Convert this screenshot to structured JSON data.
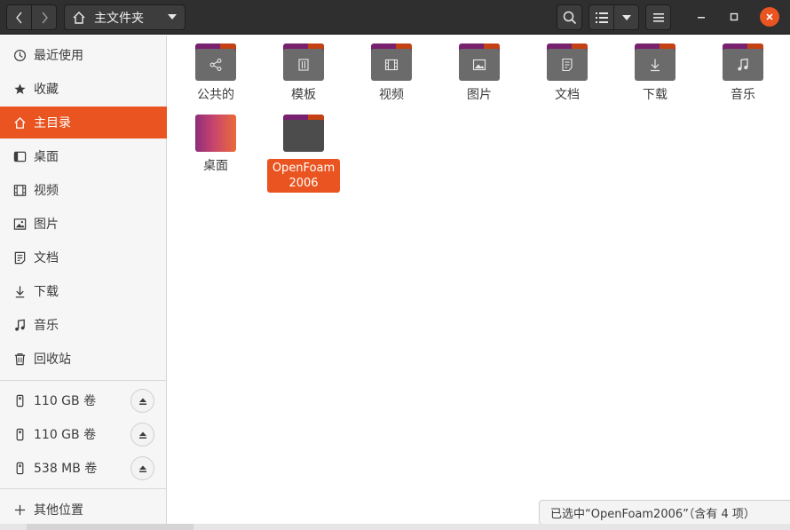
{
  "header": {
    "path_label": "主文件夹"
  },
  "sidebar": {
    "places": [
      {
        "label": "最近使用",
        "icon": "clock-icon"
      },
      {
        "label": "收藏",
        "icon": "star-icon"
      },
      {
        "label": "主目录",
        "icon": "home-icon",
        "active": true
      },
      {
        "label": "桌面",
        "icon": "desktop-icon"
      },
      {
        "label": "视频",
        "icon": "film-icon"
      },
      {
        "label": "图片",
        "icon": "picture-icon"
      },
      {
        "label": "文档",
        "icon": "document-icon"
      },
      {
        "label": "下载",
        "icon": "download-icon"
      },
      {
        "label": "音乐",
        "icon": "music-icon"
      },
      {
        "label": "回收站",
        "icon": "trash-icon"
      }
    ],
    "devices": [
      {
        "label": "110 GB 卷",
        "icon": "usb-drive-icon"
      },
      {
        "label": "110 GB 卷",
        "icon": "usb-drive-icon"
      },
      {
        "label": "538 MB 卷",
        "icon": "usb-drive-icon"
      }
    ],
    "other_locations": "其他位置"
  },
  "files": [
    {
      "name": "公共的",
      "icon": "share-icon"
    },
    {
      "name": "模板",
      "icon": "template-icon"
    },
    {
      "name": "视频",
      "icon": "film-icon"
    },
    {
      "name": "图片",
      "icon": "picture-icon"
    },
    {
      "name": "文档",
      "icon": "document-icon"
    },
    {
      "name": "下载",
      "icon": "download-icon"
    },
    {
      "name": "音乐",
      "icon": "music-icon"
    },
    {
      "name": "桌面",
      "icon": "desktop-icon"
    },
    {
      "name": "OpenFoam\n2006",
      "icon": "folder-icon",
      "selected": true
    }
  ],
  "status": "已选中“OpenFoam2006”（含有 4 项）",
  "colors": {
    "accent": "#e95420",
    "header_bg": "#2f2f2f",
    "sidebar_bg": "#f6f6f6"
  }
}
